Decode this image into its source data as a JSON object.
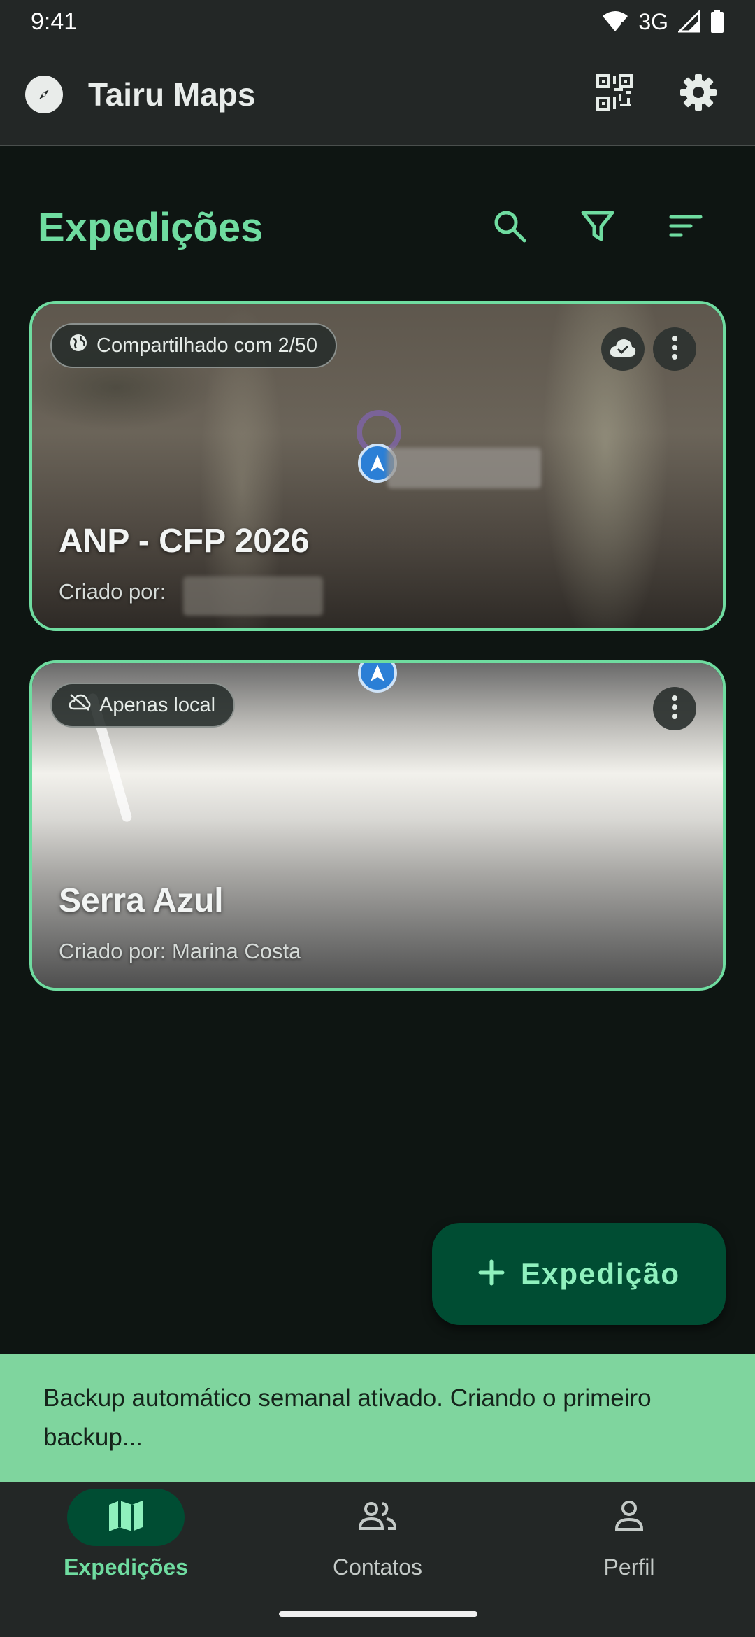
{
  "status_bar": {
    "time": "9:41",
    "network": "3G"
  },
  "app_bar": {
    "title": "Tairu Maps",
    "logo_icon": "compass-icon",
    "actions": [
      "qr-code-icon",
      "gear-icon"
    ]
  },
  "section": {
    "title": "Expedições",
    "actions": [
      "search-icon",
      "filter-icon",
      "sort-icon"
    ]
  },
  "expeditions": [
    {
      "chip": "Compartilhado com 2/50",
      "chip_icon": "globe-icon",
      "synced": true,
      "title": "ANP - CFP 2026",
      "created_by_label": "Criado por:",
      "created_by": ""
    },
    {
      "chip": "Apenas local",
      "chip_icon": "cloud-off-icon",
      "synced": false,
      "title": "Serra Azul",
      "created_by_label": "Criado por:",
      "created_by": "Marina Costa"
    }
  ],
  "fab": {
    "label": "Expedição",
    "icon": "plus-icon"
  },
  "snackbar": {
    "message": "Backup automático semanal ativado. Criando o primeiro backup..."
  },
  "bottom_nav": {
    "items": [
      {
        "label": "Expedições",
        "icon": "map-icon",
        "active": true
      },
      {
        "label": "Contatos",
        "icon": "people-icon",
        "active": false
      },
      {
        "label": "Perfil",
        "icon": "person-icon",
        "active": false
      }
    ]
  },
  "colors": {
    "accent": "#6fdca0",
    "fab_bg": "#004d33",
    "snackbar_bg": "#7fd59e",
    "bar_bg": "#232726",
    "background": "#0e1512"
  }
}
